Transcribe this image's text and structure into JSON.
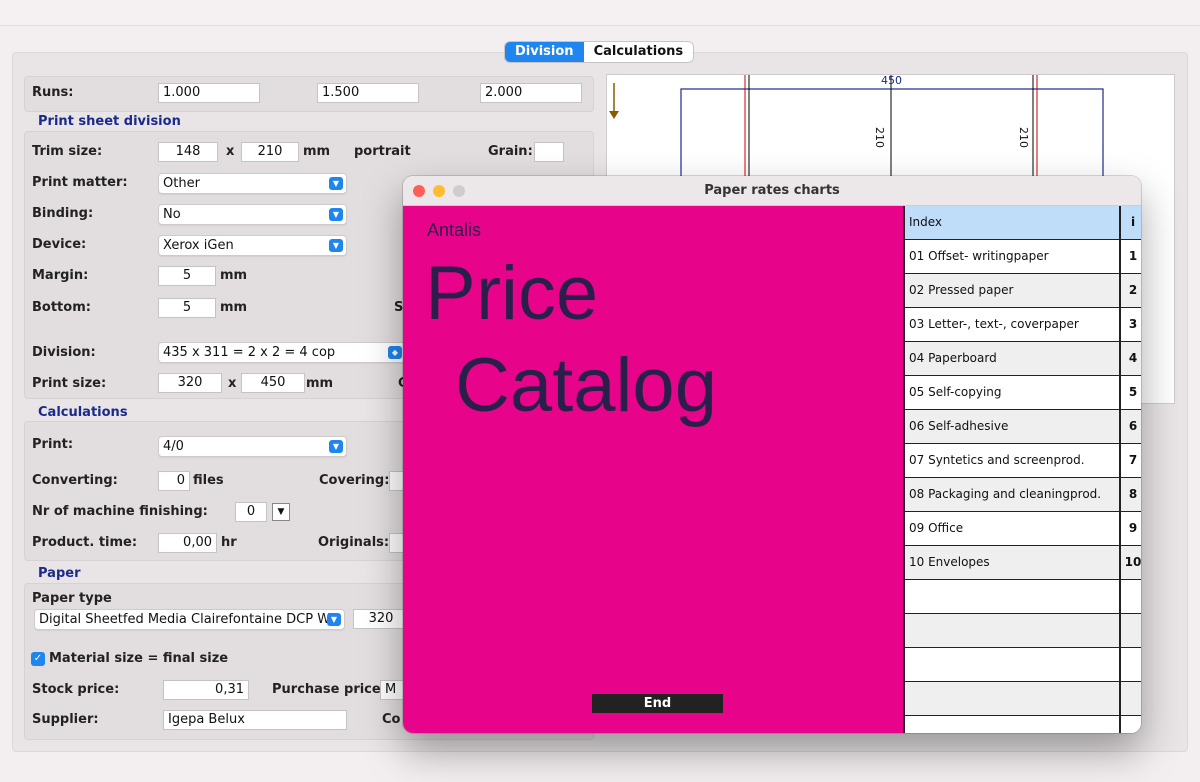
{
  "tabs": {
    "division": "Division",
    "calculations": "Calculations"
  },
  "runs": {
    "label": "Runs:",
    "values": [
      "1.000",
      "1.500",
      "2.000"
    ]
  },
  "print_sheet": {
    "title": "Print sheet division",
    "trim_label": "Trim size:",
    "trim_w": "148",
    "x1": "x",
    "trim_h": "210",
    "mm1": "mm",
    "orientation": "portrait",
    "grain_label": "Grain:",
    "print_matter_label": "Print matter:",
    "print_matter": "Other",
    "binding_label": "Binding:",
    "binding": "No",
    "device_label": "Device:",
    "device": "Xerox iGen",
    "margin_label": "Margin:",
    "margin": "5",
    "mm2": "mm",
    "bottom_label": "Bottom:",
    "bottom": "5",
    "mm3": "mm",
    "bottom_trail": "S",
    "division_label": "Division:",
    "division": "435 x 311 = 2 x 2 = 4 cop",
    "print_size_label": "Print size:",
    "ps_w": "320",
    "x2": "x",
    "ps_h": "450",
    "mm4": "mm",
    "ps_trail": "C"
  },
  "calculations": {
    "title": "Calculations",
    "print_label": "Print:",
    "print": "4/0",
    "converting_label": "Converting:",
    "converting": "0",
    "files": "files",
    "covering_label": "Covering:",
    "machine_label": "Nr of machine finishing:",
    "machine": "0",
    "product_label": "Product. time:",
    "product": "0,00",
    "hr": "hr",
    "originals_label": "Originals:"
  },
  "paper": {
    "title": "Paper",
    "type_label": "Paper type",
    "type": "Digital Sheetfed Media Clairefontaine DCP W",
    "size": "320",
    "material_label": "Material size = final size",
    "stock_label": "Stock price:",
    "stock": "0,31",
    "purchase_label": "Purchase price:",
    "purchase": "M",
    "supplier_label": "Supplier:",
    "supplier": "Igepa Belux",
    "co_label": "Co"
  },
  "preview": {
    "width_label": "450",
    "h1": "210",
    "h2": "210"
  },
  "modal": {
    "title": "Paper rates charts",
    "brand": "Antalis",
    "line1": "Price",
    "line2": "Catalog",
    "end": "End",
    "header": {
      "name": "Index",
      "num": "i"
    },
    "rows": [
      {
        "name": "01 Offset- writingpaper",
        "num": "1"
      },
      {
        "name": "02 Pressed paper",
        "num": "2"
      },
      {
        "name": "03 Letter-, text-, coverpaper",
        "num": "3"
      },
      {
        "name": "04 Paperboard",
        "num": "4"
      },
      {
        "name": "05 Self-copying",
        "num": "5"
      },
      {
        "name": "06 Self-adhesive",
        "num": "6"
      },
      {
        "name": "07 Syntetics and screenprod.",
        "num": "7"
      },
      {
        "name": "08 Packaging and cleaningprod.",
        "num": "8"
      },
      {
        "name": "09 Office",
        "num": "9"
      },
      {
        "name": "10 Envelopes",
        "num": "10"
      }
    ]
  },
  "colors": {
    "accent": "#1f86ef",
    "pink": "#e8048a",
    "navy_text": "#2a1f4a",
    "section": "#1a2a8a"
  }
}
